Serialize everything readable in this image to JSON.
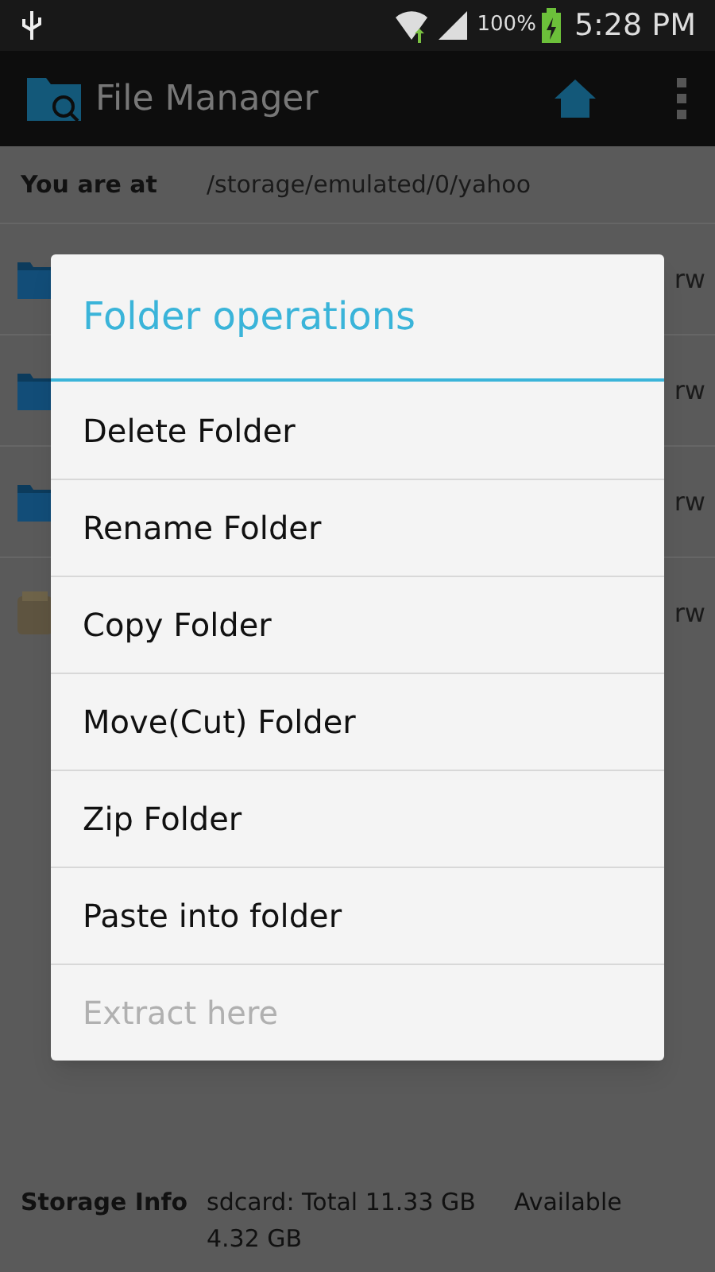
{
  "status_bar": {
    "battery": "100%",
    "time": "5:28 PM"
  },
  "action_bar": {
    "title": "File Manager"
  },
  "location": {
    "label": "You are at",
    "path": "/storage/emulated/0/yahoo"
  },
  "files": [
    {
      "kind": "folder",
      "permissions": "rw"
    },
    {
      "kind": "folder",
      "permissions": "rw"
    },
    {
      "kind": "folder",
      "permissions": "rw"
    },
    {
      "kind": "archive",
      "permissions": "rw"
    }
  ],
  "dialog": {
    "title": "Folder operations",
    "items": [
      {
        "label": "Delete Folder",
        "disabled": false
      },
      {
        "label": "Rename Folder",
        "disabled": false
      },
      {
        "label": "Copy Folder",
        "disabled": false
      },
      {
        "label": "Move(Cut) Folder",
        "disabled": false
      },
      {
        "label": "Zip Folder",
        "disabled": false
      },
      {
        "label": "Paste into folder",
        "disabled": false
      },
      {
        "label": "Extract here",
        "disabled": true
      }
    ]
  },
  "storage": {
    "label": "Storage Info",
    "line_1": "sdcard: Total 11.33 GB",
    "line_2": "Available",
    "line_3": "4.32 GB"
  }
}
